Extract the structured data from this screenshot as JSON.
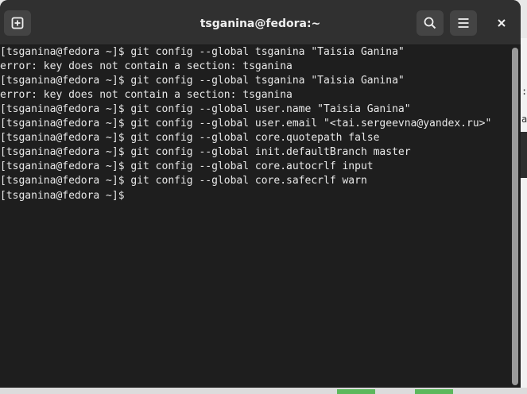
{
  "window": {
    "title": "tsganina@fedora:~"
  },
  "headerbar": {
    "new_tab_icon": "new-tab-icon",
    "search_icon": "search-icon",
    "menu_icon": "hamburger-menu-icon",
    "close_icon": "close-icon"
  },
  "terminal": {
    "lines": [
      "[tsganina@fedora ~]$ git config --global tsganina \"Taisia Ganina\"",
      "error: key does not contain a section: tsganina",
      "[tsganina@fedora ~]$ git config --global tsganina \"Taisia Ganina\"",
      "error: key does not contain a section: tsganina",
      "[tsganina@fedora ~]$ git config --global user.name \"Taisia Ganina\"",
      "[tsganina@fedora ~]$ git config --global user.email \"<tai.sergeevna@yandex.ru>\"",
      "[tsganina@fedora ~]$ git config --global core.quotepath false",
      "[tsganina@fedora ~]$ git config --global init.defaultBranch master",
      "[tsganina@fedora ~]$ git config --global core.autocrlf input",
      "[tsganina@fedora ~]$ git config --global core.safecrlf warn",
      "[tsganina@fedora ~]$ "
    ]
  },
  "background": {
    "fragment_1": ":/",
    "fragment_2": "az"
  },
  "colors": {
    "headerbar": "#303030",
    "terminal_bg": "#1e1e1e",
    "terminal_fg": "#e8e8e8",
    "button_bg": "#444444",
    "accent_green": "#5cb85c"
  }
}
